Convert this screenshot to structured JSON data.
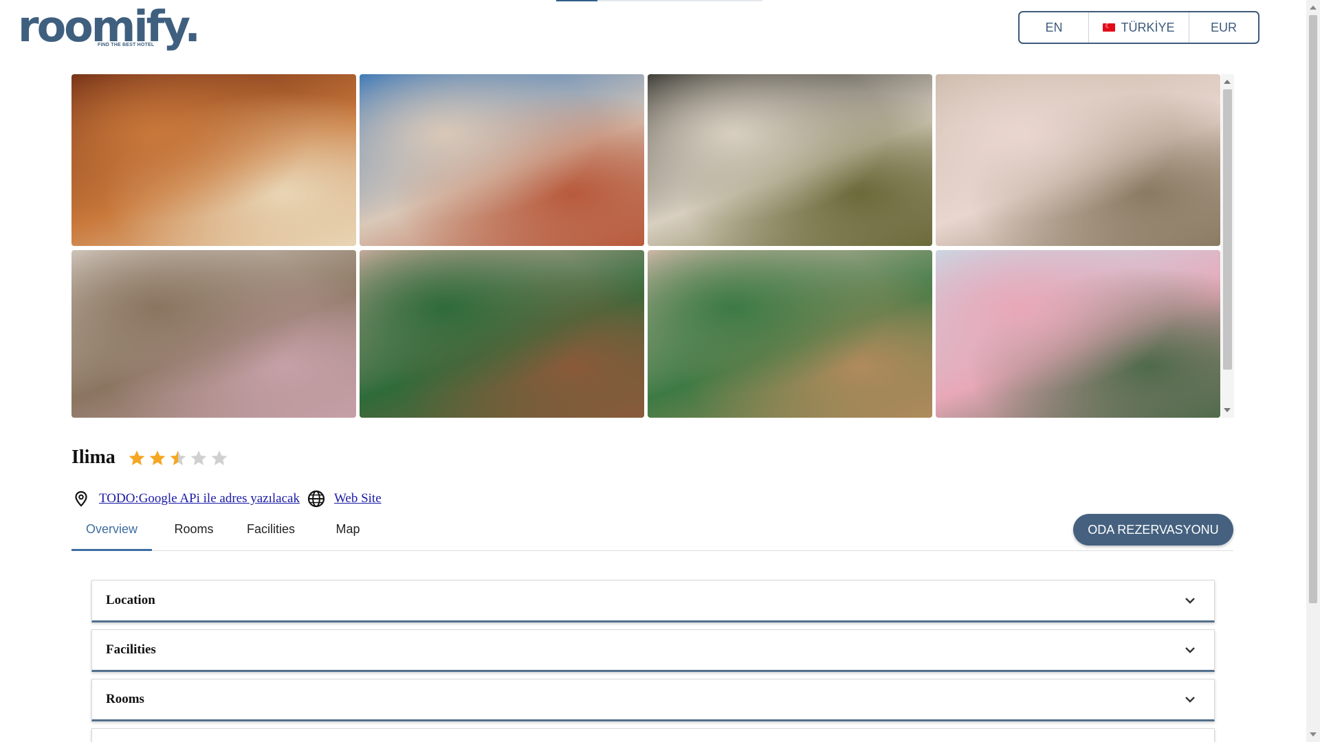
{
  "header": {
    "logo_text": "roomify.",
    "logo_tagline": "FIND THE BEST HOTEL",
    "language": "EN",
    "country": "TÜRKİYE",
    "currency": "EUR",
    "page_load_progress": 0.2
  },
  "gallery": {
    "photos": [
      {
        "subject": "Hotel lobby reception desk",
        "colors": [
          "#6b2a14",
          "#c9783a",
          "#e8d5b5"
        ]
      },
      {
        "subject": "Hotel tower exterior",
        "colors": [
          "#2a6fb8",
          "#d9c8b8",
          "#b85a3c"
        ]
      },
      {
        "subject": "Room with lamps and desk",
        "colors": [
          "#2a2a26",
          "#d8cfc0",
          "#6b6a3a"
        ]
      },
      {
        "subject": "Suite with kitchenette and sofa",
        "colors": [
          "#c9b8a8",
          "#e9d6cf",
          "#8a7a62"
        ]
      },
      {
        "subject": "Room with two beds and balcony view",
        "colors": [
          "#d8cfc6",
          "#8a7560",
          "#c6a0a8"
        ]
      },
      {
        "subject": "Room with green twin beds",
        "colors": [
          "#d9b2a8",
          "#2f6b3a",
          "#8a5a3a"
        ]
      },
      {
        "subject": "Bedroom with green bed and dresser",
        "colors": [
          "#e0c0b4",
          "#3d7a44",
          "#b08a5c"
        ]
      },
      {
        "subject": "Balcony view over the city",
        "colors": [
          "#c7dbe8",
          "#e8a8b8",
          "#4f6a4a"
        ]
      }
    ]
  },
  "hotel": {
    "name": "Ilima",
    "rating": 2.5,
    "rating_max": 5,
    "address_link": "TODO:Google APi ile adres yazılacak",
    "website_link": "Web Site"
  },
  "tabs": [
    {
      "label": "Overview",
      "active": true
    },
    {
      "label": "Rooms",
      "active": false
    },
    {
      "label": "Facilities",
      "active": false
    },
    {
      "label": "Map",
      "active": false
    }
  ],
  "reserve_button": "ODA REZERVASYONU",
  "accordion": [
    {
      "label": "Location"
    },
    {
      "label": "Facilities"
    },
    {
      "label": "Rooms"
    },
    {
      "label": ""
    }
  ],
  "colors": {
    "brand": "#3f5f7f",
    "accent": "#45617f",
    "link": "#1a1aa6",
    "star": "#f5a623",
    "star_empty": "#d0d0d0"
  }
}
